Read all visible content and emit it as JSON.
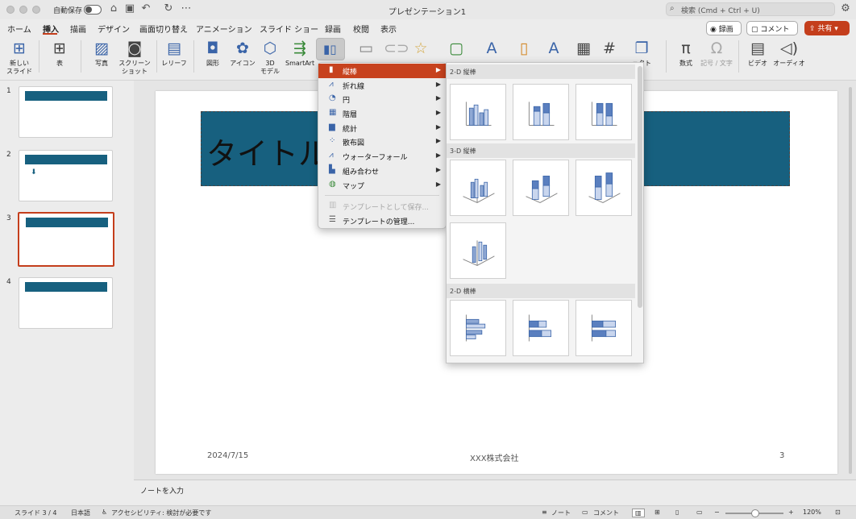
{
  "app": {
    "title": "プレゼンテーション1",
    "autosave_label": "自動保存",
    "search_placeholder": "検索 (Cmd + Ctrl + U)"
  },
  "ribbon_tabs": [
    "ホーム",
    "挿入",
    "描画",
    "デザイン",
    "画面切り替え",
    "アニメーション",
    "スライド ショー",
    "録画",
    "校閲",
    "表示"
  ],
  "active_tab": "挿入",
  "top_buttons": {
    "record": "録画",
    "comment": "コメント",
    "share": "共有"
  },
  "ribbon": {
    "new_slide": "新しい\nスライド",
    "table": "表",
    "picture": "写真",
    "screenshot": "スクリーン\nショット",
    "relief": "レリーフ",
    "shapes": "図形",
    "icons": "アイコン",
    "model3d": "3D\nモデル",
    "smartart": "SmartArt",
    "partial_right": "ェクト",
    "equation": "数式",
    "symbol": "記号 / 文字",
    "video": "ビデオ",
    "audio": "オーディオ"
  },
  "slides": [
    {
      "num": "1"
    },
    {
      "num": "2"
    },
    {
      "num": "3",
      "selected": true
    },
    {
      "num": "4"
    }
  ],
  "slide": {
    "title": "タイトルを",
    "date": "2024/7/15",
    "company": "XXX株式会社",
    "page": "3"
  },
  "notes_placeholder": "ノートを入力",
  "status": {
    "slide_count": "スライド 3 / 4",
    "language": "日本語",
    "accessibility": "アクセシビリティ: 検討が必要です",
    "notes": "ノート",
    "comments": "コメント",
    "zoom": "120%"
  },
  "chart_menu": {
    "items": [
      {
        "label": "縦棒",
        "icon": "column-chart-icon",
        "active": true,
        "submenu": true
      },
      {
        "label": "折れ線",
        "icon": "line-chart-icon",
        "submenu": true
      },
      {
        "label": "円",
        "icon": "pie-chart-icon",
        "submenu": true
      },
      {
        "label": "階層",
        "icon": "hierarchy-chart-icon",
        "submenu": true
      },
      {
        "label": "統計",
        "icon": "statistic-chart-icon",
        "submenu": true
      },
      {
        "label": "散布図",
        "icon": "scatter-chart-icon",
        "submenu": true
      },
      {
        "label": "ウォーターフォール",
        "icon": "waterfall-chart-icon",
        "submenu": true
      },
      {
        "label": "組み合わせ",
        "icon": "combo-chart-icon",
        "submenu": true
      },
      {
        "label": "マップ",
        "icon": "map-chart-icon",
        "submenu": true
      }
    ],
    "template_items": [
      {
        "label": "テンプレートとして保存...",
        "disabled": true
      },
      {
        "label": "テンプレートの管理...",
        "disabled": false
      }
    ]
  },
  "gallery": {
    "sections": [
      "2-D 縦棒",
      "3-D 縦棒",
      "2-D 横棒"
    ]
  },
  "colors": {
    "accent": "#c43e1c",
    "slide_title_bg": "#17607f",
    "chart_blue": "#3a64a8"
  }
}
